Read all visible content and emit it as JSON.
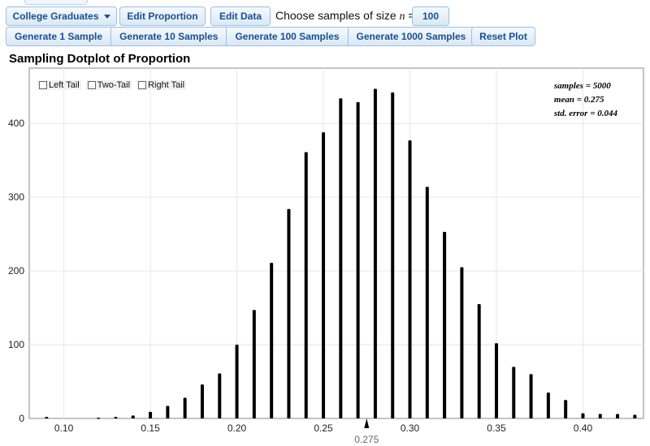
{
  "toolbar": {
    "dataset_label": "College Graduates",
    "edit_proportion_label": "Edit Proportion",
    "edit_data_label": "Edit Data",
    "sample_size_text": "Choose samples of size",
    "n_symbol": "n",
    "equals": "=",
    "sample_size_value": "100",
    "generate_buttons": [
      "Generate 1 Sample",
      "Generate 10 Samples",
      "Generate 100 Samples",
      "Generate 1000 Samples"
    ],
    "reset_label": "Reset Plot"
  },
  "plot": {
    "title": "Sampling Dotplot of Proportion",
    "tails": [
      "Left Tail",
      "Two-Tail",
      "Right Tail"
    ],
    "stats": [
      "samples = 5000",
      "mean = 0.275",
      "std. error = 0.044"
    ],
    "mean_marker_label": "0.275"
  },
  "colors": {
    "button_text": "#1b4f8a",
    "bars": "#000000",
    "grid": "#e6e6e6"
  },
  "chart_data": {
    "type": "bar",
    "x": [
      0.09,
      0.12,
      0.13,
      0.14,
      0.15,
      0.16,
      0.17,
      0.18,
      0.19,
      0.2,
      0.21,
      0.22,
      0.23,
      0.24,
      0.25,
      0.26,
      0.27,
      0.28,
      0.29,
      0.3,
      0.31,
      0.32,
      0.33,
      0.34,
      0.35,
      0.36,
      0.37,
      0.38,
      0.39,
      0.4,
      0.41,
      0.42,
      0.43
    ],
    "values": [
      2,
      1,
      2,
      4,
      9,
      17,
      28,
      46,
      61,
      100,
      147,
      211,
      284,
      361,
      388,
      434,
      429,
      447,
      442,
      377,
      314,
      253,
      205,
      155,
      102,
      70,
      60,
      35,
      25,
      7,
      6,
      6,
      5
    ],
    "xlim": [
      0.08,
      0.435
    ],
    "ylim": [
      0,
      475
    ],
    "xticks": [
      0.1,
      0.15,
      0.2,
      0.25,
      0.3,
      0.35,
      0.4
    ],
    "xtick_labels": [
      "0.10",
      "0.15",
      "0.20",
      "0.25",
      "0.30",
      "0.35",
      "0.40"
    ],
    "yticks": [
      0,
      100,
      200,
      300,
      400
    ],
    "ytick_labels": [
      "0",
      "100",
      "200",
      "300",
      "400"
    ],
    "mean": 0.275,
    "grid": true
  }
}
